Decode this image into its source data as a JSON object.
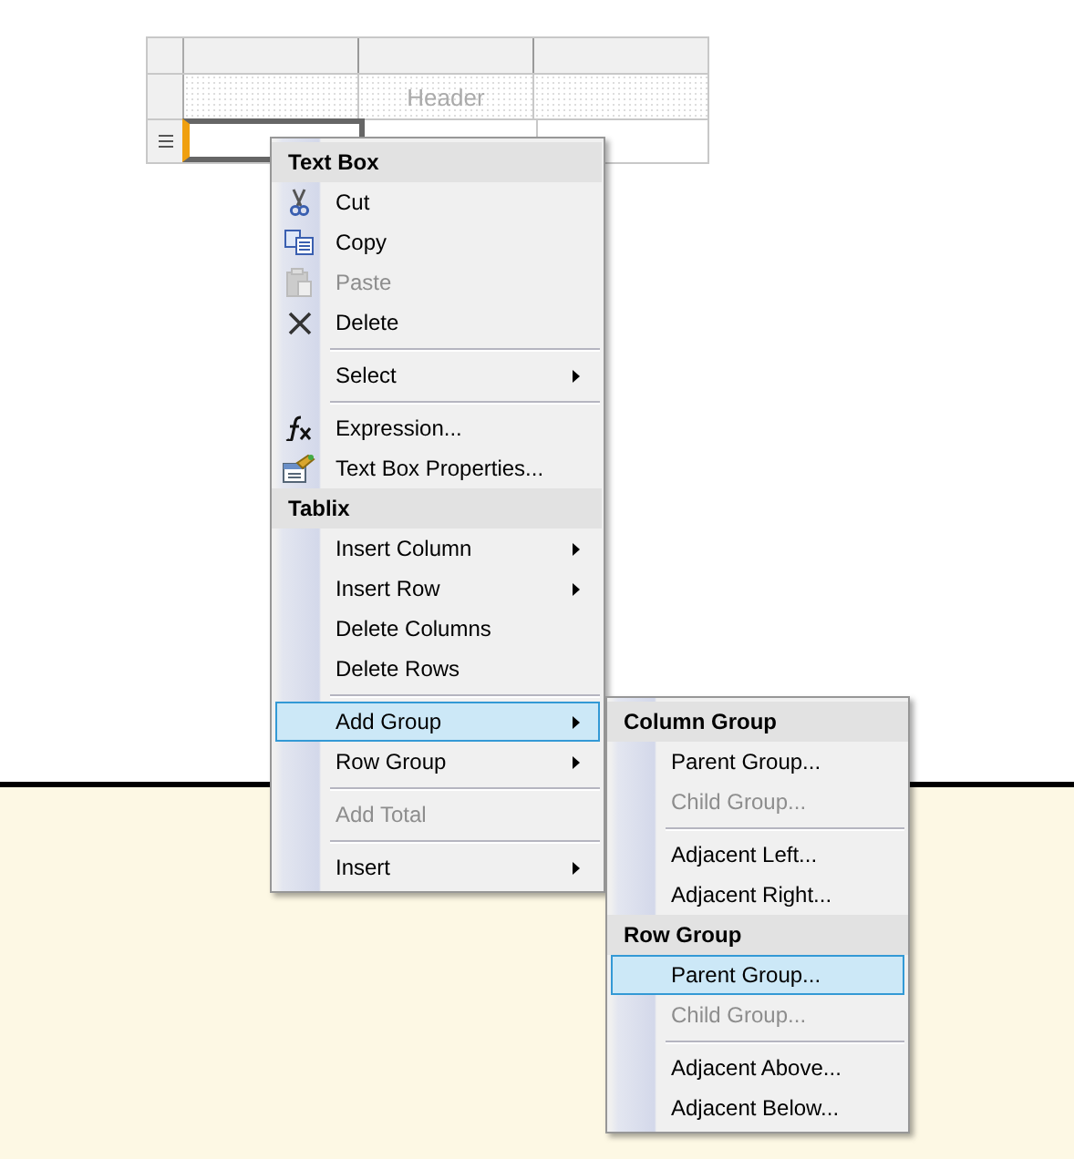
{
  "table": {
    "rows": [
      {
        "kind": "columns",
        "cells": [
          "",
          "",
          ""
        ]
      },
      {
        "kind": "header",
        "cells": [
          "",
          "Header",
          ""
        ]
      },
      {
        "kind": "data",
        "cells": [
          "",
          "",
          ""
        ]
      }
    ]
  },
  "context_menu": {
    "items": [
      {
        "kind": "header",
        "label": "Text Box"
      },
      {
        "kind": "item",
        "label": "Cut",
        "disabled": false,
        "selected": false,
        "submenu": false
      },
      {
        "kind": "item",
        "label": "Copy",
        "disabled": false,
        "selected": false,
        "submenu": false
      },
      {
        "kind": "item",
        "label": "Paste",
        "disabled": true,
        "selected": false,
        "submenu": false
      },
      {
        "kind": "item",
        "label": "Delete",
        "disabled": false,
        "selected": false,
        "submenu": false
      },
      {
        "kind": "separator"
      },
      {
        "kind": "item",
        "label": "Select",
        "disabled": false,
        "selected": false,
        "submenu": true
      },
      {
        "kind": "separator"
      },
      {
        "kind": "item",
        "label": "Expression...",
        "disabled": false,
        "selected": false,
        "submenu": false
      },
      {
        "kind": "item",
        "label": "Text Box Properties...",
        "disabled": false,
        "selected": false,
        "submenu": false
      },
      {
        "kind": "header",
        "label": "Tablix"
      },
      {
        "kind": "item",
        "label": "Insert Column",
        "disabled": false,
        "selected": false,
        "submenu": true
      },
      {
        "kind": "item",
        "label": "Insert Row",
        "disabled": false,
        "selected": false,
        "submenu": true
      },
      {
        "kind": "item",
        "label": "Delete Columns",
        "disabled": false,
        "selected": false,
        "submenu": false
      },
      {
        "kind": "item",
        "label": "Delete Rows",
        "disabled": false,
        "selected": false,
        "submenu": false
      },
      {
        "kind": "separator"
      },
      {
        "kind": "item",
        "label": "Add Group",
        "disabled": false,
        "selected": true,
        "submenu": true
      },
      {
        "kind": "item",
        "label": "Row Group",
        "disabled": false,
        "selected": false,
        "submenu": true
      },
      {
        "kind": "separator"
      },
      {
        "kind": "item",
        "label": "Add Total",
        "disabled": true,
        "selected": false,
        "submenu": false
      },
      {
        "kind": "separator"
      },
      {
        "kind": "item",
        "label": "Insert",
        "disabled": false,
        "selected": false,
        "submenu": true
      }
    ]
  },
  "submenu": {
    "items": [
      {
        "kind": "header",
        "label": "Column Group"
      },
      {
        "kind": "item",
        "label": "Parent Group...",
        "disabled": false,
        "selected": false,
        "submenu": false
      },
      {
        "kind": "item",
        "label": "Child Group...",
        "disabled": true,
        "selected": false,
        "submenu": false
      },
      {
        "kind": "separator"
      },
      {
        "kind": "item",
        "label": "Adjacent Left...",
        "disabled": false,
        "selected": false,
        "submenu": false
      },
      {
        "kind": "item",
        "label": "Adjacent Right...",
        "disabled": false,
        "selected": false,
        "submenu": false
      },
      {
        "kind": "header",
        "label": "Row Group"
      },
      {
        "kind": "item",
        "label": "Parent Group...",
        "disabled": false,
        "selected": true,
        "submenu": false
      },
      {
        "kind": "item",
        "label": "Child Group...",
        "disabled": true,
        "selected": false,
        "submenu": false
      },
      {
        "kind": "separator"
      },
      {
        "kind": "item",
        "label": "Adjacent Above...",
        "disabled": false,
        "selected": false,
        "submenu": false
      },
      {
        "kind": "item",
        "label": "Adjacent Below...",
        "disabled": false,
        "selected": false,
        "submenu": false
      }
    ]
  }
}
